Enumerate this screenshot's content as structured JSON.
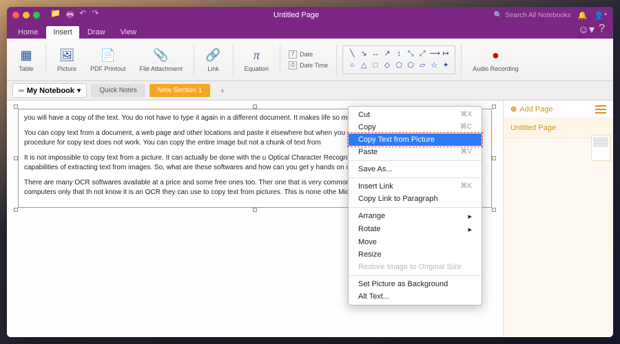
{
  "titlebar": {
    "title": "Untitled Page",
    "search_placeholder": "Search All Notebooks"
  },
  "tabs": {
    "items": [
      "Home",
      "Insert",
      "Draw",
      "View"
    ],
    "active": 1
  },
  "ribbon": {
    "table": "Table",
    "picture": "Picture",
    "pdf": "PDF Printout",
    "file": "File Attachment",
    "link": "Link",
    "equation": "Equation",
    "date": "Date",
    "date_time": "Date Time",
    "audio": "Audio Recording",
    "date_chip": "7"
  },
  "notebook": {
    "name": "My Notebook",
    "sections": [
      "Quick Notes",
      "New Section 1"
    ]
  },
  "document": {
    "p1": "you will have a copy of the text. You do not have to type it again in a different document. It makes life so much easier.",
    "p2": "You can copy text from a document, a web page and other locations and paste it elsewhere but when you are dealing with an image the usual procedure for copy text does not work. You can copy the entire image but not a chunk of text from",
    "p3": "It is not impossible to copy text from a picture. It can actually be done with the u Optical Character Recognition (OCR) software. These have the capabilities of extracting text from images. So, what are these softwares and how can you get y hands on one?",
    "p4": "There are many OCR softwares available at a price and some free ones too. Ther one that is very common and many people have it on their computers only that th not know it is an OCR they can use to copy text from pictures. This is none othe Microsoft OneNote."
  },
  "context_menu": {
    "cut": "Cut",
    "copy": "Copy",
    "copy_text": "Copy Text from Picture",
    "paste": "Paste",
    "save_as": "Save As...",
    "insert_link": "Insert Link",
    "copy_link_para": "Copy Link to Paragraph",
    "arrange": "Arrange",
    "rotate": "Rotate",
    "move": "Move",
    "resize": "Resize",
    "restore": "Restore Image to Original Size",
    "set_bg": "Set Picture as Background",
    "alt_text": "Alt Text...",
    "sc_cut": "⌘X",
    "sc_copy": "⌘C",
    "sc_paste": "⌘V",
    "sc_link": "⌘K"
  },
  "sidepanel": {
    "add_page": "Add Page",
    "page1": "Untitled Page"
  },
  "colors": {
    "traffic_close": "#ff5f57",
    "traffic_min": "#febc2e",
    "traffic_max": "#28c840"
  }
}
